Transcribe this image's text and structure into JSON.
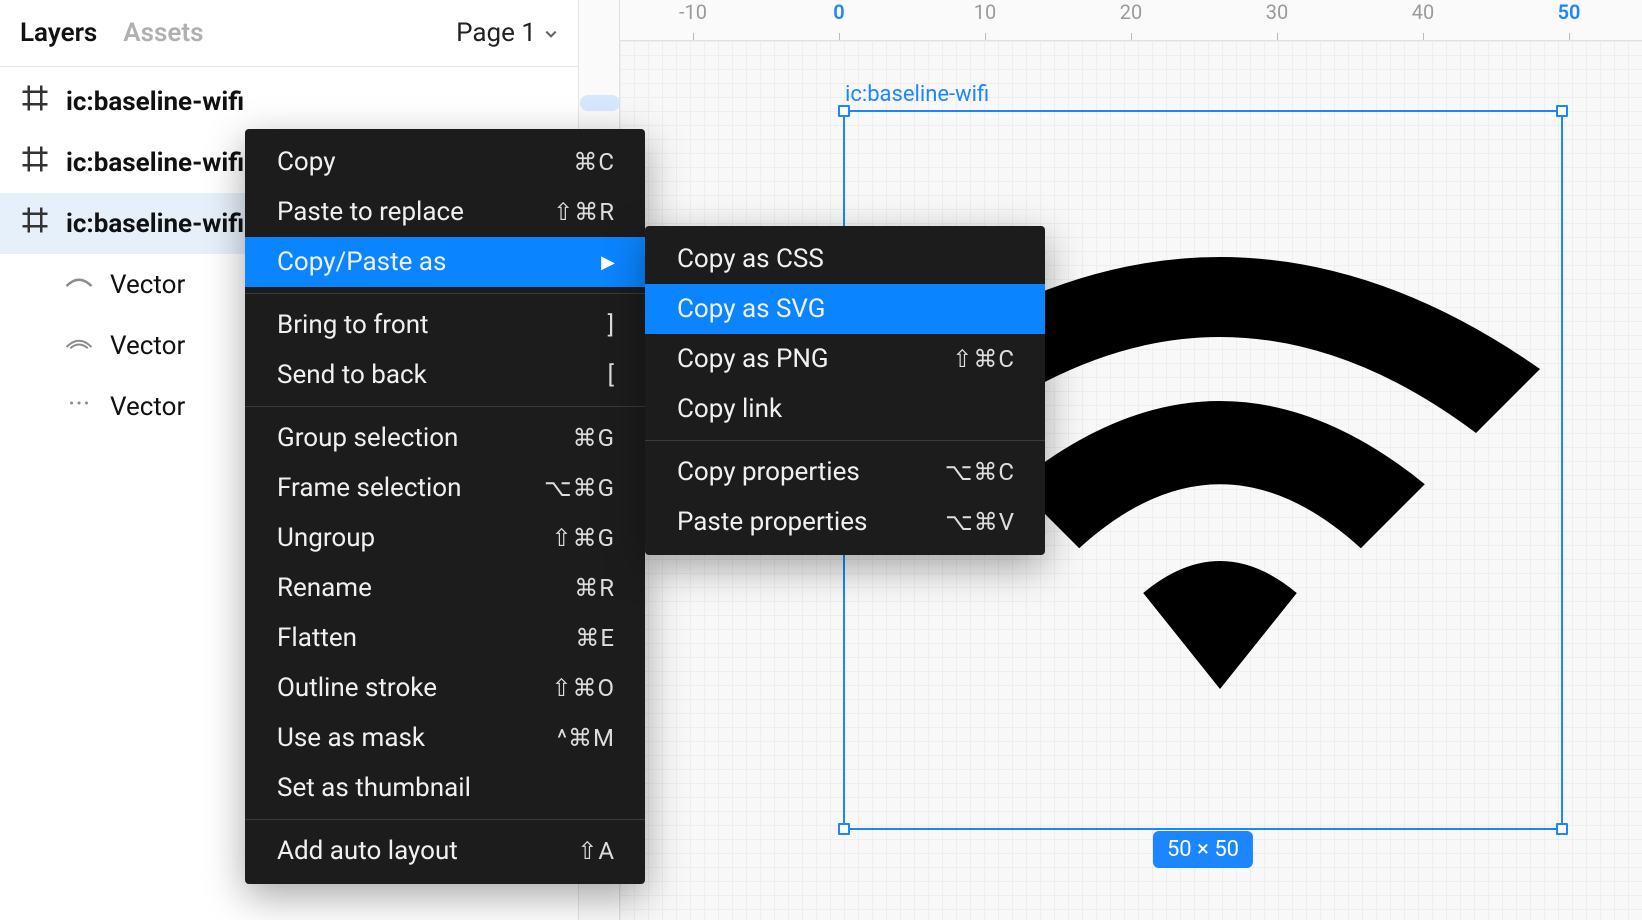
{
  "panel": {
    "tabs": {
      "layers": "Layers",
      "assets": "Assets"
    },
    "page_label": "Page 1"
  },
  "layers": [
    {
      "name": "ic:baseline-wifi",
      "type": "frame",
      "selected": false
    },
    {
      "name": "ic:baseline-wifi",
      "type": "frame",
      "selected": false
    },
    {
      "name": "ic:baseline-wifi",
      "type": "frame",
      "selected": true
    },
    {
      "name": "Vector",
      "type": "vector",
      "child": true
    },
    {
      "name": "Vector",
      "type": "vector",
      "child": true
    },
    {
      "name": "Vector",
      "type": "vector",
      "child": true
    }
  ],
  "ruler": {
    "ticks": [
      "-10",
      "0",
      "10",
      "20",
      "30",
      "40",
      "50"
    ]
  },
  "frame": {
    "label": "ic:baseline-wifi",
    "dimensions": "50 × 50"
  },
  "context_menu_primary": [
    {
      "label": "Copy",
      "shortcut": "⌘C"
    },
    {
      "label": "Paste to replace",
      "shortcut": "⇧⌘R"
    },
    {
      "label": "Copy/Paste as",
      "shortcut": "",
      "submenu": true,
      "highlight": true
    },
    {
      "sep": true
    },
    {
      "label": "Bring to front",
      "shortcut": "]"
    },
    {
      "label": "Send to back",
      "shortcut": "["
    },
    {
      "sep": true
    },
    {
      "label": "Group selection",
      "shortcut": "⌘G"
    },
    {
      "label": "Frame selection",
      "shortcut": "⌥⌘G"
    },
    {
      "label": "Ungroup",
      "shortcut": "⇧⌘G"
    },
    {
      "label": "Rename",
      "shortcut": "⌘R"
    },
    {
      "label": "Flatten",
      "shortcut": "⌘E"
    },
    {
      "label": "Outline stroke",
      "shortcut": "⇧⌘O"
    },
    {
      "label": "Use as mask",
      "shortcut": "^⌘M"
    },
    {
      "label": "Set as thumbnail",
      "shortcut": ""
    },
    {
      "sep": true
    },
    {
      "label": "Add auto layout",
      "shortcut": "⇧A"
    }
  ],
  "context_menu_secondary": [
    {
      "label": "Copy as CSS",
      "shortcut": ""
    },
    {
      "label": "Copy as SVG",
      "shortcut": "",
      "highlight": true
    },
    {
      "label": "Copy as PNG",
      "shortcut": "⇧⌘C"
    },
    {
      "label": "Copy link",
      "shortcut": ""
    },
    {
      "sep": true
    },
    {
      "label": "Copy properties",
      "shortcut": "⌥⌘C"
    },
    {
      "label": "Paste properties",
      "shortcut": "⌥⌘V"
    }
  ]
}
